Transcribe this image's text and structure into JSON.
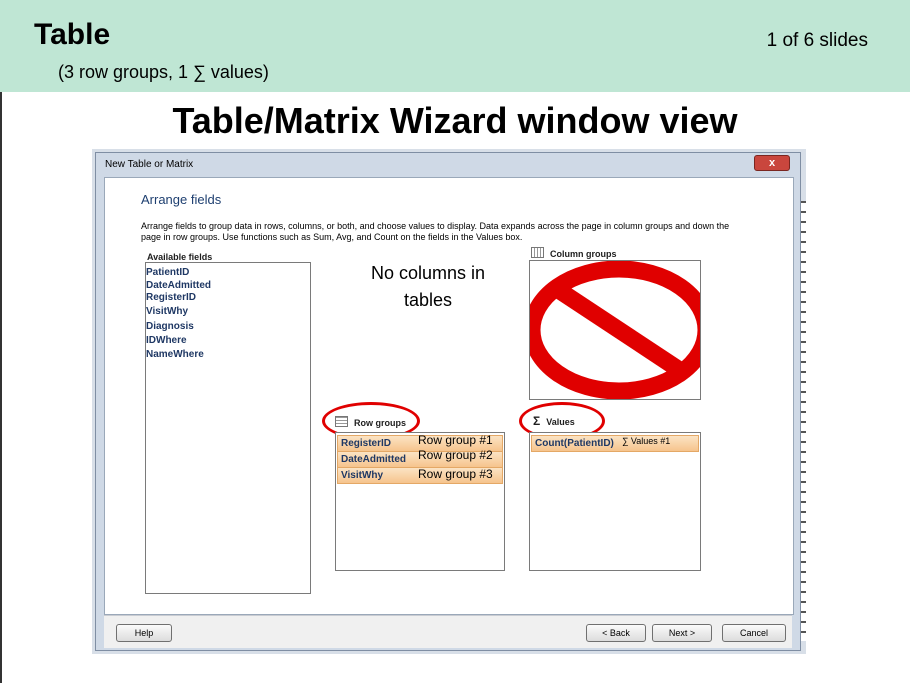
{
  "header": {
    "title": "Table",
    "subtitle": "(3 row groups, 1 ∑ values)",
    "slide_counter": "1 of 6 slides"
  },
  "slide_title": "Table/Matrix Wizard window view",
  "dialog": {
    "window_title": "New Table or Matrix",
    "close_glyph": "x",
    "heading": "Arrange fields",
    "description": "Arrange fields to group data in rows, columns, or both, and choose values to display. Data expands across the page in column groups and down the page in row groups.  Use functions such as Sum, Avg, and Count on the fields in the Values box.",
    "available_fields_label": "Available fields",
    "available_fields": [
      "PatientID",
      "DateAdmitted",
      "RegisterID",
      "VisitWhy",
      "Diagnosis",
      " IDWhere",
      "NameWhere"
    ],
    "column_groups_label": "Column groups",
    "row_groups_label": "Row groups",
    "row_groups": [
      "RegisterID",
      "DateAdmitted",
      "VisitWhy"
    ],
    "values_label": "Values",
    "values": [
      "Count(PatientID)"
    ],
    "buttons": {
      "help": "Help",
      "back": "< Back",
      "next": "Next >",
      "cancel": "Cancel"
    }
  },
  "annotations": {
    "no_columns_line1": "No columns in",
    "no_columns_line2": "tables",
    "row_group_labels": [
      "Row group #1",
      "Row group #2",
      "Row group #3"
    ],
    "values_label": "∑ Values #1"
  },
  "icons": {
    "prohibition": "prohibition-sign-icon",
    "column_groups": "grid-icon",
    "row_groups": "rows-icon",
    "values": "sigma-icon"
  },
  "colors": {
    "header_bg": "#bfe6d4",
    "prohibition_red": "#e00000",
    "chip_fill": "#f6c48d",
    "highlight_ring": "#e00000"
  }
}
